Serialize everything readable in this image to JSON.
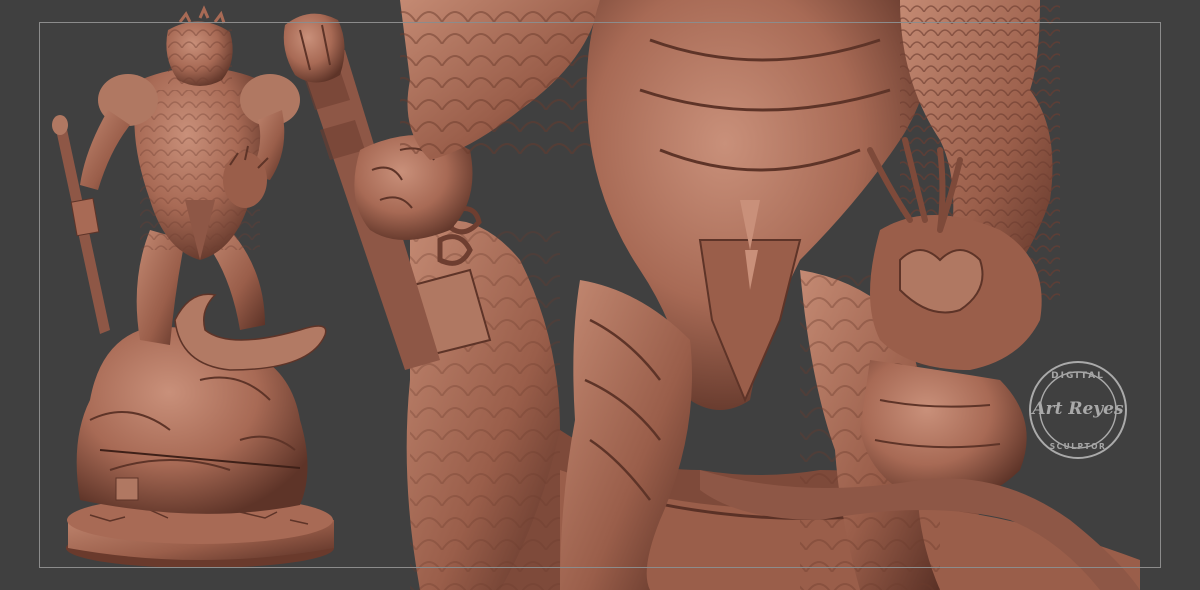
{
  "scene": {
    "background_color": "#404040",
    "frame_color": "#8c8c8c",
    "clay_color": "#a86a55",
    "clay_shadow_color": "#5e3428",
    "clay_highlight_color": "#c9907a"
  },
  "watermark": {
    "top_text": "DIGITAL",
    "bottom_text": "SCULPTOR",
    "signature": "Art Reyes"
  }
}
